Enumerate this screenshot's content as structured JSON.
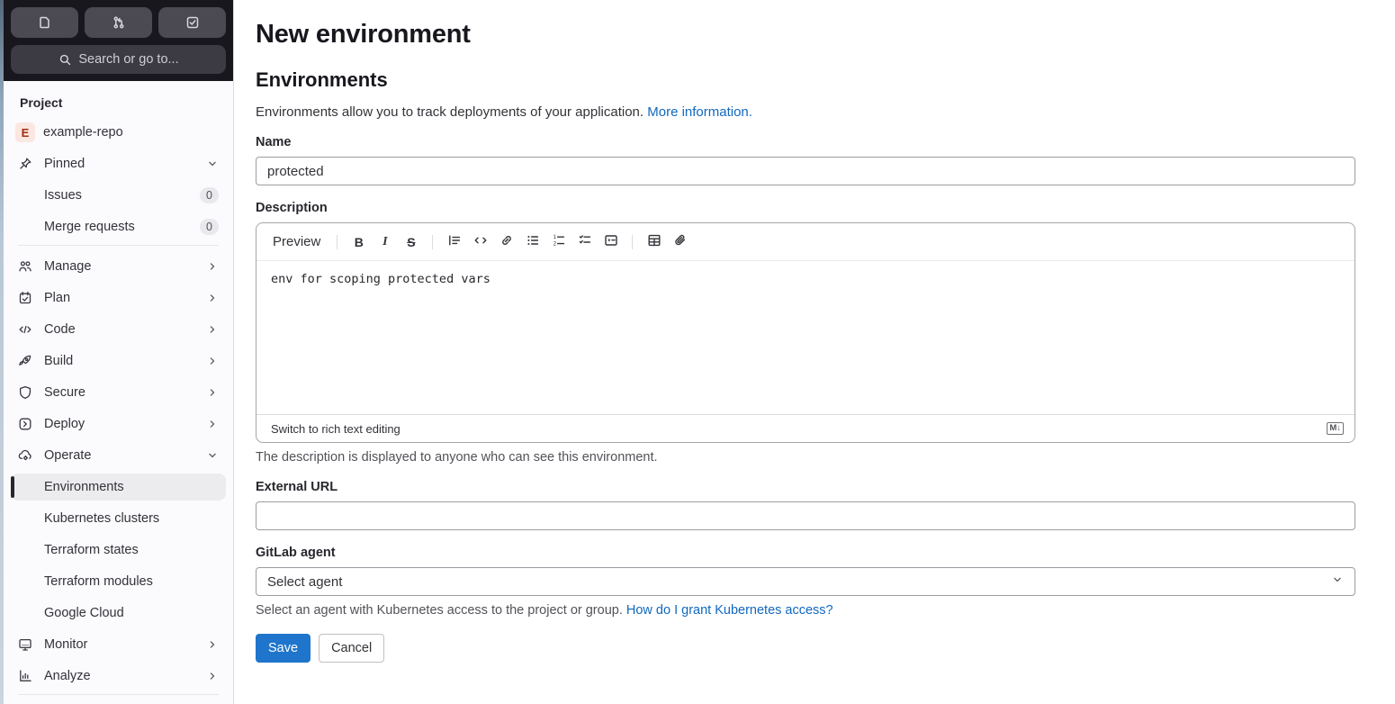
{
  "colors": {
    "accent_blue": "#1f75cb",
    "link_blue": "#1068bf",
    "header_dark": "#18171d",
    "sidebar_bg": "#fbfafd",
    "active_item_bg": "#ececef",
    "avatar_bg": "#fbe7e2",
    "avatar_text": "#a02f12"
  },
  "sidebar": {
    "search": {
      "placeholder": "Search or go to..."
    },
    "section_label": "Project",
    "project": {
      "avatar_letter": "E",
      "name": "example-repo"
    },
    "pinned": {
      "label": "Pinned"
    },
    "pinned_items": [
      {
        "label": "Issues",
        "badge": "0"
      },
      {
        "label": "Merge requests",
        "badge": "0"
      }
    ],
    "nav": [
      {
        "label": "Manage"
      },
      {
        "label": "Plan"
      },
      {
        "label": "Code"
      },
      {
        "label": "Build"
      },
      {
        "label": "Secure"
      },
      {
        "label": "Deploy"
      },
      {
        "label": "Operate"
      }
    ],
    "operate_children": [
      {
        "label": "Environments"
      },
      {
        "label": "Kubernetes clusters"
      },
      {
        "label": "Terraform states"
      },
      {
        "label": "Terraform modules"
      },
      {
        "label": "Google Cloud"
      }
    ],
    "nav_bottom": [
      {
        "label": "Monitor"
      },
      {
        "label": "Analyze"
      }
    ]
  },
  "main": {
    "page_title": "New environment",
    "section_title": "Environments",
    "intro": {
      "text": "Environments allow you to track deployments of your application.",
      "link": "More information."
    },
    "name": {
      "label": "Name",
      "value": "protected"
    },
    "description": {
      "label": "Description",
      "toolbar": {
        "preview_tab": "Preview",
        "bold_glyph": "B",
        "italic_glyph": "I",
        "strike_glyph": "S"
      },
      "value": "env for scoping protected vars",
      "switch_link": "Switch to rich text editing",
      "markdown_badge": "M↓",
      "help": "The description is displayed to anyone who can see this environment."
    },
    "external_url": {
      "label": "External URL",
      "value": ""
    },
    "agent": {
      "label": "GitLab agent",
      "value": "Select agent",
      "help": "Select an agent with Kubernetes access to the project or group.",
      "help_link": "How do I grant Kubernetes access?"
    },
    "actions": {
      "save": "Save",
      "cancel": "Cancel"
    }
  }
}
